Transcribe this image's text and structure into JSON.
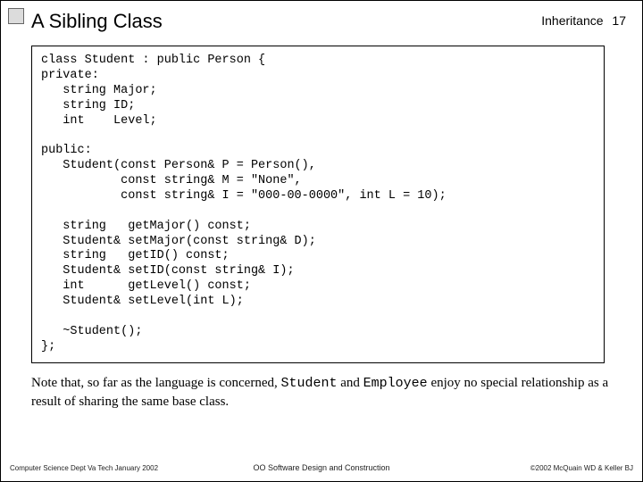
{
  "header": {
    "title": "A Sibling Class",
    "topic": "Inheritance",
    "page": "17"
  },
  "code": "class Student : public Person {\nprivate:\n   string Major;\n   string ID;\n   int    Level;\n\npublic:\n   Student(const Person& P = Person(),\n           const string& M = \"None\",\n           const string& I = \"000-00-0000\", int L = 10);\n\n   string   getMajor() const;\n   Student& setMajor(const string& D);\n   string   getID() const;\n   Student& setID(const string& I);\n   int      getLevel() const;\n   Student& setLevel(int L);\n\n   ~Student();\n};",
  "note": {
    "pre": "Note that, so far as the language is concerned, ",
    "code1": "Student",
    "mid": " and ",
    "code2": "Employee",
    "post": " enjoy no special relationship as a result of sharing the same base class."
  },
  "footer": {
    "left": "Computer Science Dept Va Tech January 2002",
    "center": "OO Software Design and Construction",
    "right": "©2002 McQuain WD & Keller BJ"
  }
}
